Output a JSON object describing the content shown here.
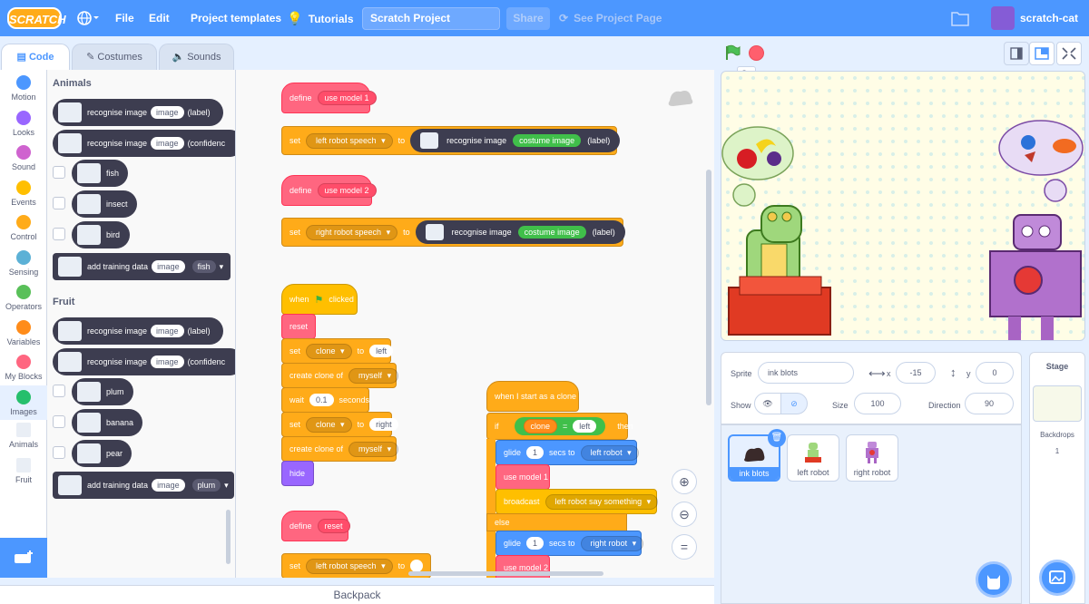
{
  "menubar": {
    "logo": "SCRATCH",
    "file": "File",
    "edit": "Edit",
    "templates": "Project templates",
    "tutorials": "Tutorials",
    "project_title": "Scratch Project",
    "share": "Share",
    "see_project_page": "See Project Page",
    "username": "scratch-cat"
  },
  "tabs": {
    "code": "Code",
    "costumes": "Costumes",
    "sounds": "Sounds"
  },
  "categories": [
    {
      "label": "Motion",
      "color": "#4c97ff"
    },
    {
      "label": "Looks",
      "color": "#9966ff"
    },
    {
      "label": "Sound",
      "color": "#cf63cf"
    },
    {
      "label": "Events",
      "color": "#ffbf00"
    },
    {
      "label": "Control",
      "color": "#ffab19"
    },
    {
      "label": "Sensing",
      "color": "#5cb1d6"
    },
    {
      "label": "Operators",
      "color": "#59c059"
    },
    {
      "label": "Variables",
      "color": "#ff8c1a"
    },
    {
      "label": "My Blocks",
      "color": "#ff6680"
    },
    {
      "label": "Images",
      "color": "#26bf6c"
    },
    {
      "label": "Animals",
      "color": ""
    },
    {
      "label": "Fruit",
      "color": ""
    }
  ],
  "palette": {
    "animals_heading": "Animals",
    "fruit_heading": "Fruit",
    "recognise": "recognise image",
    "image": "image",
    "label": "(label)",
    "confidence": "(confidenc",
    "fish": "fish",
    "insect": "insect",
    "bird": "bird",
    "add_training": "add training data",
    "plum": "plum",
    "banana": "banana",
    "pear": "pear"
  },
  "workspace": {
    "define": "define",
    "use_model_1": "use model 1",
    "use_model_2": "use model 2",
    "set": "set",
    "to": "to",
    "left_robot_speech": "left robot speech",
    "right_robot_speech": "right robot speech",
    "recognise": "recognise image",
    "costume_image": "costume image",
    "label": "(label)",
    "when": "when",
    "clicked": "clicked",
    "reset": "reset",
    "clone": "clone",
    "left": "left",
    "right": "right",
    "create_clone_of": "create clone of",
    "myself": "myself",
    "wait": "wait",
    "wait_value": "0.1",
    "seconds": "seconds",
    "hide": "hide",
    "when_clone": "when I start as a clone",
    "if": "if",
    "equals": "=",
    "then": "then",
    "glide": "glide",
    "glide_value": "1",
    "secs_to": "secs to",
    "left_robot": "left robot",
    "right_robot": "right robot",
    "broadcast": "broadcast",
    "left_robot_say": "left robot say something",
    "else": "else",
    "define_reset": "reset"
  },
  "backpack": "Backpack",
  "stage_header": {
    "go_tooltip": "Go"
  },
  "sprite_info": {
    "sprite_label": "Sprite",
    "sprite_name": "ink blots",
    "x_label": "x",
    "x_value": "-15",
    "y_label": "y",
    "y_value": "0",
    "show_label": "Show",
    "size_label": "Size",
    "size_value": "100",
    "direction_label": "Direction",
    "direction_value": "90"
  },
  "sprites": [
    "ink blots",
    "left robot",
    "right robot"
  ],
  "stage_panel": {
    "title": "Stage",
    "backdrops_label": "Backdrops",
    "backdrops_count": "1"
  }
}
